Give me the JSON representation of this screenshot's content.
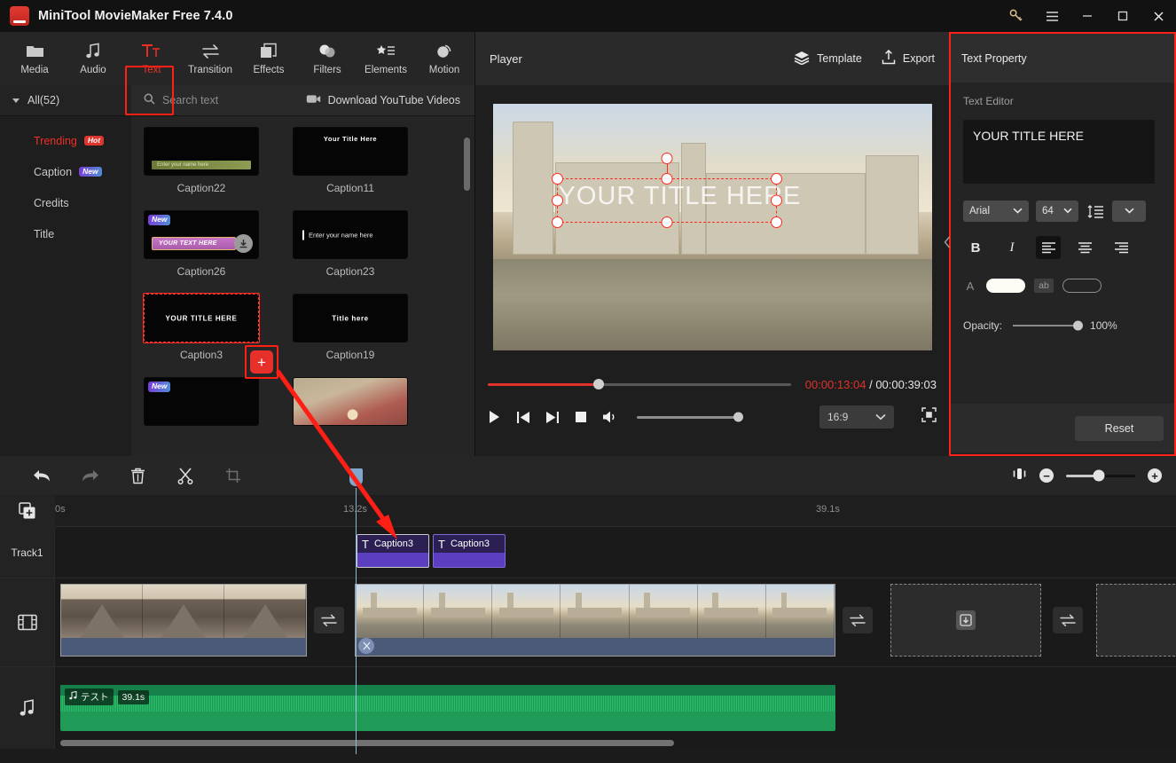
{
  "titlebar": {
    "app_title": "MiniTool MovieMaker Free 7.4.0",
    "icons": {
      "key": "key-icon",
      "menu": "hamburger-icon",
      "minimize": "minimize-icon",
      "maximize": "maximize-icon",
      "close": "close-icon"
    }
  },
  "tabs": [
    {
      "label": "Media",
      "icon": "folder-icon",
      "active": false
    },
    {
      "label": "Audio",
      "icon": "music-note-icon",
      "active": false
    },
    {
      "label": "Text",
      "icon": "text-icon",
      "active": true
    },
    {
      "label": "Transition",
      "icon": "transition-arrows-icon",
      "active": false
    },
    {
      "label": "Effects",
      "icon": "layers-icon",
      "active": false
    },
    {
      "label": "Filters",
      "icon": "droplets-icon",
      "active": false
    },
    {
      "label": "Elements",
      "icon": "star-list-icon",
      "active": false
    },
    {
      "label": "Motion",
      "icon": "motion-icon",
      "active": false
    }
  ],
  "subbar": {
    "all_label": "All(52)",
    "search_placeholder": "Search text",
    "download_label": "Download YouTube Videos"
  },
  "categories": [
    {
      "label": "Trending",
      "badge": "Hot",
      "badge_type": "hot",
      "selected": true
    },
    {
      "label": "Caption",
      "badge": "New",
      "badge_type": "new",
      "selected": false
    },
    {
      "label": "Credits",
      "badge": "",
      "badge_type": "",
      "selected": false
    },
    {
      "label": "Title",
      "badge": "",
      "badge_type": "",
      "selected": false
    }
  ],
  "templates": [
    {
      "name": "Caption22",
      "preview_text": "Enter your name here",
      "style": "greenbar",
      "badge": "",
      "has_download": false,
      "selected": false
    },
    {
      "name": "Caption11",
      "preview_text": "Your Title Here",
      "style": "topcenter",
      "badge": "",
      "has_download": false,
      "selected": false
    },
    {
      "name": "Caption26",
      "preview_text": "YOUR TEXT HERE",
      "style": "ribbon",
      "badge": "New",
      "has_download": true,
      "selected": false
    },
    {
      "name": "Caption23",
      "preview_text": "Enter your name here",
      "style": "nameline",
      "badge": "",
      "has_download": false,
      "selected": false
    },
    {
      "name": "Caption3",
      "preview_text": "YOUR TITLE HERE",
      "style": "center",
      "badge": "",
      "has_download": false,
      "selected": true
    },
    {
      "name": "Caption19",
      "preview_text": "Title here",
      "style": "center",
      "badge": "",
      "has_download": false,
      "selected": false
    },
    {
      "name": "",
      "preview_text": "",
      "style": "blank",
      "badge": "New",
      "has_download": false,
      "selected": false
    },
    {
      "name": "",
      "preview_text": "",
      "style": "sunset",
      "badge": "",
      "has_download": false,
      "selected": false
    }
  ],
  "template_add_button": "+",
  "player": {
    "title": "Player",
    "template_label": "Template",
    "export_label": "Export",
    "overlay_text": "YOUR TITLE HERE",
    "current_time": "00:00:13:04",
    "separator": "/",
    "total_time": "00:00:39:03",
    "aspect_ratio": "16:9",
    "controls": {
      "play": "play-icon",
      "prev": "previous-frame-icon",
      "next": "next-frame-icon",
      "stop": "stop-icon",
      "volume": "volume-icon",
      "fullscreen": "fullscreen-icon"
    }
  },
  "text_property": {
    "title": "Text Property",
    "section_label": "Text Editor",
    "text_value": "YOUR TITLE HERE",
    "font_family": "Arial",
    "font_size": "64",
    "bold_label": "B",
    "italic_label": "I",
    "align_left": "align-left-icon",
    "align_center": "align-center-icon",
    "align_right": "align-right-icon",
    "line_spacing_icon": "line-spacing-icon",
    "more_icon": "chevron-down-icon",
    "text_color_icon": "A",
    "text_color": "#fdfdf6",
    "outline_icon": "ab",
    "outline_color": "none",
    "opacity_label": "Opacity:",
    "opacity_value": "100%",
    "reset_label": "Reset"
  },
  "timeline": {
    "tools": [
      {
        "name": "undo",
        "icon": "undo-arrow-icon",
        "enabled": true
      },
      {
        "name": "redo",
        "icon": "redo-arrow-icon",
        "enabled": false
      },
      {
        "name": "delete",
        "icon": "trash-icon",
        "enabled": true
      },
      {
        "name": "split",
        "icon": "scissors-icon",
        "enabled": true
      },
      {
        "name": "crop",
        "icon": "crop-icon",
        "enabled": false
      }
    ],
    "zoom": {
      "fit_icon": "fit-timeline-icon",
      "minus": "−",
      "plus": "+"
    },
    "ruler_ticks": [
      "0s",
      "13.2s",
      "39.1s"
    ],
    "add_track_icon": "add-track-icon",
    "tracks": [
      {
        "label": "Track1",
        "type": "text"
      },
      {
        "label": "",
        "type": "video",
        "icon": "film-strip-icon"
      },
      {
        "label": "",
        "type": "audio",
        "icon": "music-note-icon"
      }
    ],
    "text_clips": [
      {
        "label": "Caption3",
        "icon": "T",
        "selected": true
      },
      {
        "label": "Caption3",
        "icon": "T",
        "selected": false
      }
    ],
    "audio_clip": {
      "name": "テスト",
      "duration": "39.1s",
      "icon": "music-note-icon"
    },
    "transition_icon": "transition-swap-icon",
    "dropzone_icon": "import-media-icon"
  },
  "colors": {
    "accent_red": "#ee2f26",
    "highlight_red": "#ff201a",
    "panel_bg": "#242424",
    "clip_purple": "#5b3fc0",
    "audio_green": "#1f9b57",
    "playhead_blue": "#8fb8d8"
  }
}
